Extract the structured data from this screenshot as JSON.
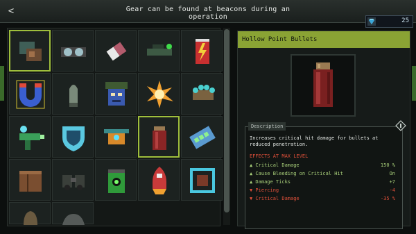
{
  "header": {
    "back_label": "<",
    "banner": "Gear can be found at beacons during an operation",
    "currency_value": "25",
    "currency_icon": "diamond-gem-icon"
  },
  "gear_grid": {
    "selected": "hollow-point-bullets",
    "items": [
      "gear-item-1",
      "gear-item-2",
      "gear-item-3",
      "gear-item-4",
      "gear-item-5",
      "gear-item-6",
      "gear-item-7",
      "gear-item-8",
      "gear-item-9",
      "gear-item-10",
      "gear-item-11",
      "gear-item-12",
      "gear-item-13",
      "hollow-point-bullets",
      "gear-item-15",
      "gear-item-16",
      "gear-item-17",
      "gear-item-18",
      "gear-item-19",
      "gear-item-20",
      "gear-item-21",
      "gear-item-22"
    ]
  },
  "detail": {
    "title": "Hollow Point Bullets",
    "description_tab": "Description",
    "description": "Increases critical hit damage for bullets at reduced penetration.",
    "effects_header": "EFFECTS AT MAX LEVEL",
    "effects": [
      {
        "name": "Critical Damage",
        "value": "150 %",
        "kind": "positive"
      },
      {
        "name": "Cause Bleeding on Critical Hit",
        "value": "On",
        "kind": "positive"
      },
      {
        "name": "Damage Ticks",
        "value": "+7",
        "kind": "positive"
      },
      {
        "name": "Piercing",
        "value": "-4",
        "kind": "negative"
      },
      {
        "name": "Critical Damage",
        "value": "-35 %",
        "kind": "negative"
      }
    ]
  },
  "colors": {
    "accent": "#8aa334",
    "selected_border": "#9fbf3c",
    "positive": "#a9d07a",
    "negative": "#e0503a"
  }
}
